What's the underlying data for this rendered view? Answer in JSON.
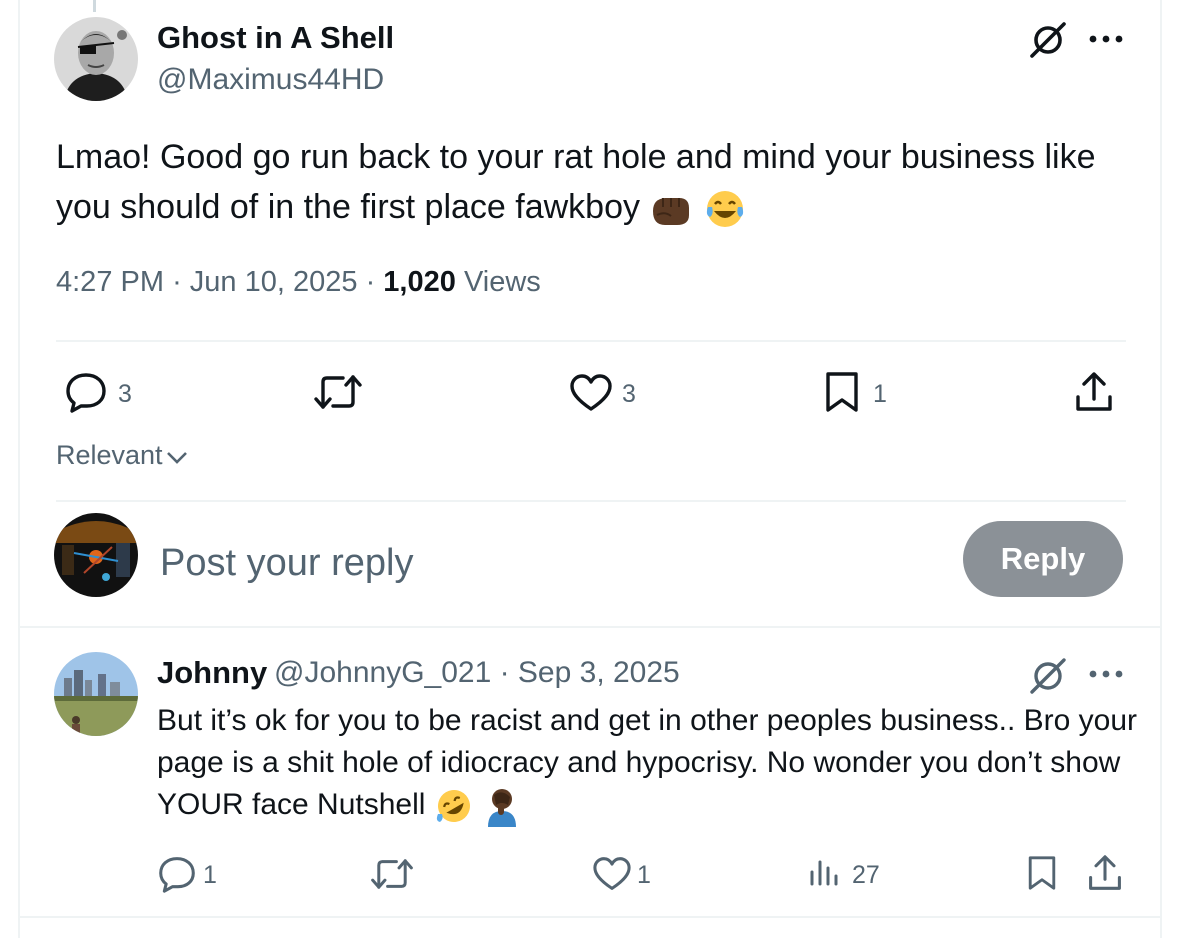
{
  "main_post": {
    "author_name": "Ghost in A Shell",
    "author_handle": "@Maximus44HD",
    "text": "Lmao! Good go run back to your rat hole and mind your business like you should of in the first place fawkboy",
    "emojis": [
      "fist-bump-emoji",
      "tears-of-joy-emoji"
    ],
    "time": "4:27 PM",
    "sep": "·",
    "date": "Jun 10, 2025",
    "views_count": "1,020",
    "views_label": "Views",
    "actions": {
      "replies": "3",
      "likes": "3",
      "bookmarks": "1"
    }
  },
  "sort": {
    "label": "Relevant"
  },
  "composer": {
    "placeholder": "Post your reply",
    "button_label": "Reply"
  },
  "reply": {
    "author_name": "Johnny",
    "author_handle": "@JohnnyG_021 · Sep 3, 2025",
    "text": "But it’s ok for you to be racist and get in other peoples business.. Bro your page is a shit hole of idiocracy and hypocrisy. No wonder you don’t show YOUR face Nutshell",
    "emojis": [
      "rolling-on-floor-laughing-emoji",
      "facepalm-emoji"
    ],
    "actions": {
      "replies": "1",
      "likes": "1",
      "views": "27"
    }
  },
  "colors": {
    "text": "#0f1419",
    "secondary": "#536471",
    "divider": "#eff3f4",
    "reply_button": "#8b9197"
  },
  "icons": [
    "grok-icon",
    "more-icon",
    "reply-icon",
    "repost-icon",
    "like-icon",
    "bookmark-icon",
    "share-icon",
    "analytics-icon",
    "chevron-down-icon"
  ]
}
